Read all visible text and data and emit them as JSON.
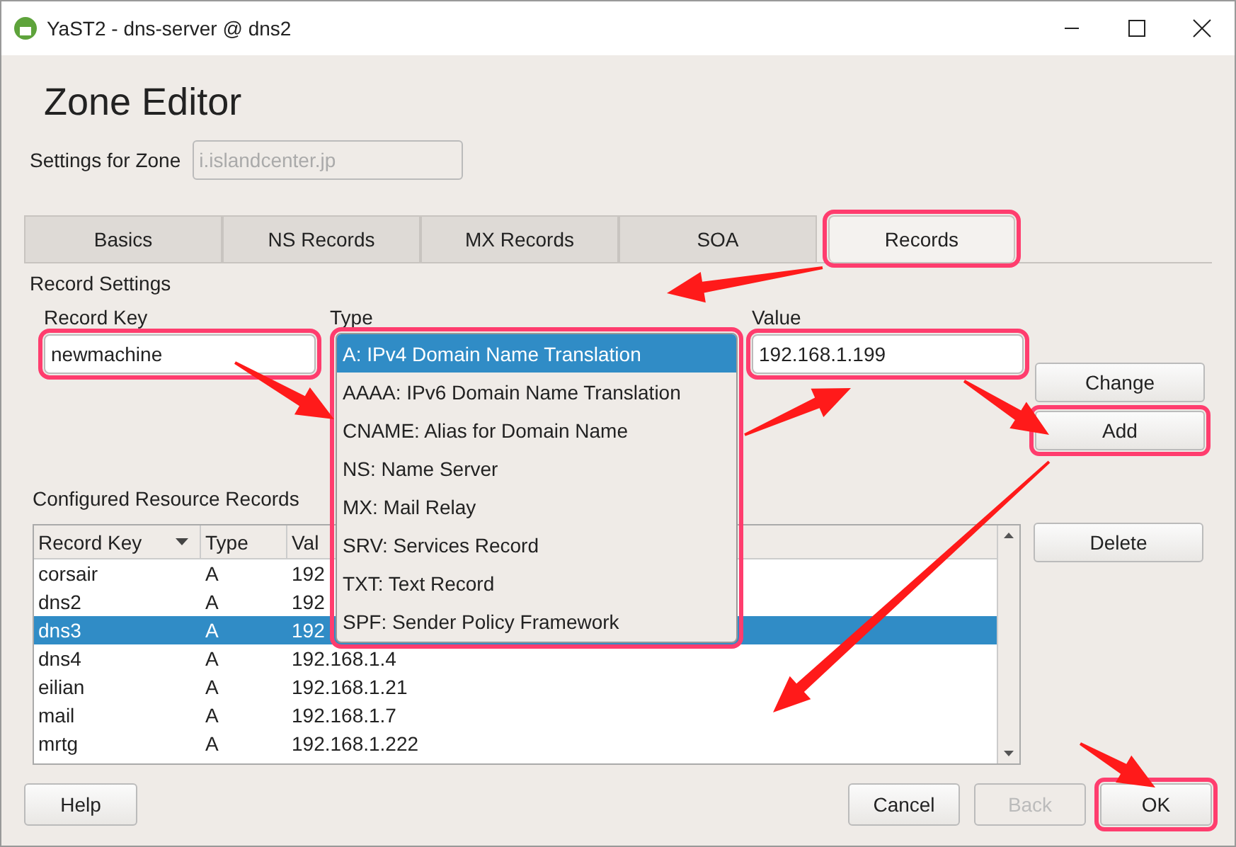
{
  "window": {
    "title": "YaST2 - dns-server @ dns2"
  },
  "heading": "Zone Editor",
  "zone": {
    "label": "Settings for Zone",
    "value": "i.islandcenter.jp",
    "disabled": true
  },
  "tabs": [
    {
      "label": "Basics",
      "selected": false,
      "highlighted": false
    },
    {
      "label": "NS Records",
      "selected": false,
      "highlighted": false
    },
    {
      "label": "MX Records",
      "selected": false,
      "highlighted": false
    },
    {
      "label": "SOA",
      "selected": false,
      "highlighted": false
    },
    {
      "label": "Records",
      "selected": true,
      "highlighted": true
    }
  ],
  "record_settings": {
    "title": "Record Settings",
    "key": {
      "label": "Record Key",
      "value": "newmachine",
      "highlighted": true
    },
    "type": {
      "label": "Type",
      "highlighted": true,
      "options": [
        {
          "label": "A: IPv4 Domain Name Translation",
          "selected": true
        },
        {
          "label": "AAAA: IPv6 Domain Name Translation",
          "selected": false
        },
        {
          "label": "CNAME: Alias for Domain Name",
          "selected": false
        },
        {
          "label": "NS: Name Server",
          "selected": false
        },
        {
          "label": "MX: Mail Relay",
          "selected": false
        },
        {
          "label": "SRV: Services Record",
          "selected": false
        },
        {
          "label": "TXT: Text Record",
          "selected": false
        },
        {
          "label": "SPF: Sender Policy Framework",
          "selected": false
        }
      ]
    },
    "value": {
      "label": "Value",
      "value": "192.168.1.199",
      "highlighted": true
    }
  },
  "side_buttons": [
    {
      "label": "Change",
      "highlighted": false
    },
    {
      "label": "Add",
      "highlighted": true
    },
    {
      "label": "Delete",
      "highlighted": false
    }
  ],
  "records": {
    "title": "Configured Resource Records",
    "columns": [
      "Record Key",
      "Type",
      "Val"
    ],
    "rows": [
      {
        "key": "corsair",
        "type": "A",
        "value": "192",
        "selected": false
      },
      {
        "key": "dns2",
        "type": "A",
        "value": "192",
        "selected": false
      },
      {
        "key": "dns3",
        "type": "A",
        "value": "192",
        "selected": true
      },
      {
        "key": "dns4",
        "type": "A",
        "value": "192.168.1.4",
        "selected": false
      },
      {
        "key": "eilian",
        "type": "A",
        "value": "192.168.1.21",
        "selected": false
      },
      {
        "key": "mail",
        "type": "A",
        "value": "192.168.1.7",
        "selected": false
      },
      {
        "key": "mrtg",
        "type": "A",
        "value": "192.168.1.222",
        "selected": false
      }
    ]
  },
  "footer": {
    "help": {
      "label": "Help",
      "disabled": false,
      "highlighted": false
    },
    "buttons": [
      {
        "label": "Cancel",
        "disabled": false,
        "highlighted": false
      },
      {
        "label": "Back",
        "disabled": true,
        "highlighted": false
      },
      {
        "label": "OK",
        "disabled": false,
        "highlighted": true
      }
    ]
  }
}
